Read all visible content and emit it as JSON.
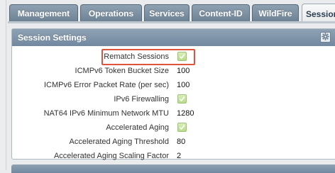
{
  "tabs": [
    {
      "label": "Management"
    },
    {
      "label": "Operations"
    },
    {
      "label": "Services"
    },
    {
      "label": "Content-ID"
    },
    {
      "label": "WildFire"
    },
    {
      "label": "Session",
      "active": true
    }
  ],
  "panel": {
    "title": "Session Settings",
    "rows": [
      {
        "label": "Rematch Sessions",
        "checked": true,
        "highlighted": true
      },
      {
        "label": "ICMPv6 Token Bucket Size",
        "value": "100"
      },
      {
        "label": "ICMPv6 Error Packet Rate (per sec)",
        "value": "100"
      },
      {
        "label": "IPv6 Firewalling",
        "checked": true
      },
      {
        "label": "NAT64 IPv6 Minimum Network MTU",
        "value": "1280"
      },
      {
        "label": "Accelerated Aging",
        "checked": true
      },
      {
        "label": "Accelerated Aging Threshold",
        "value": "80"
      },
      {
        "label": "Accelerated Aging Scaling Factor",
        "value": "2"
      }
    ]
  },
  "icons": {
    "settings": "gear-icon",
    "checked": "checkmark-icon"
  },
  "colors": {
    "tab_bg": "#7e92a4",
    "active_tab_bg": "#f0f2f3",
    "header_bg": "#8196aa",
    "check_bg": "#c5e59f",
    "highlight_border": "#e0543b"
  }
}
